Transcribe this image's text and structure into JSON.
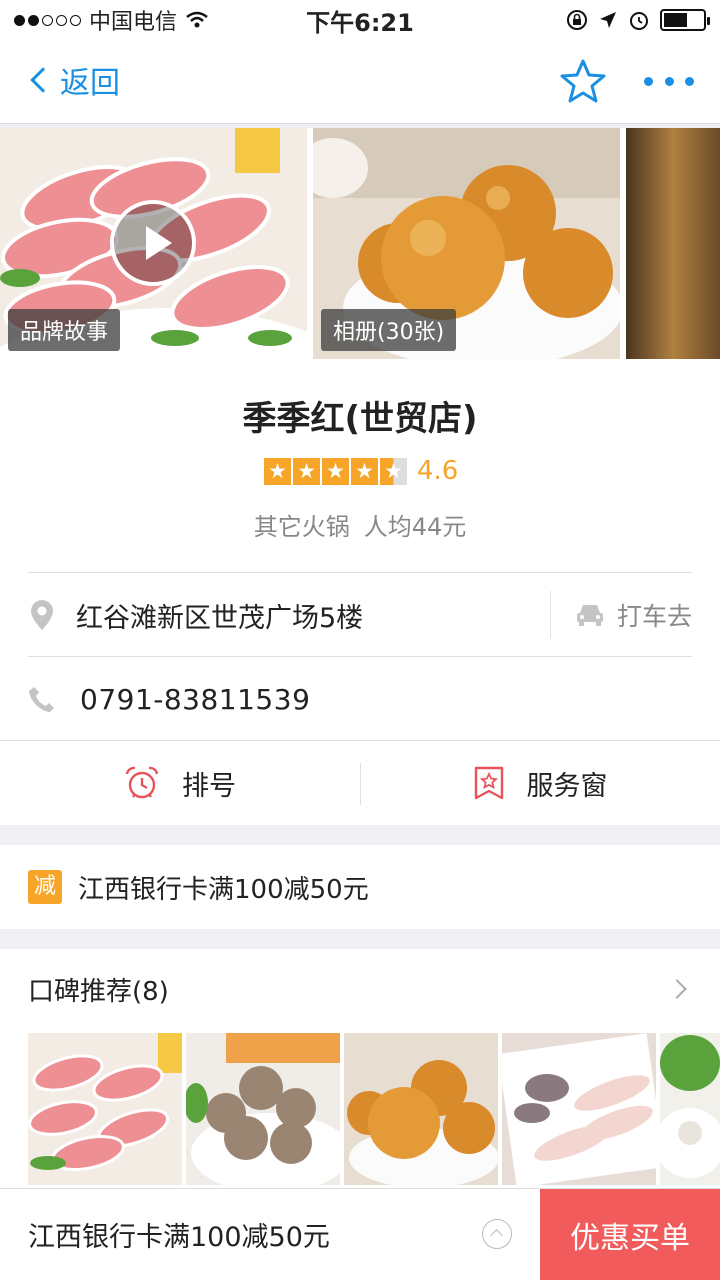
{
  "status_bar": {
    "carrier": "中国电信",
    "time": "下午6:21",
    "battery_level": 0.6
  },
  "nav": {
    "back_label": "返回",
    "icons": [
      "back-chevron-icon",
      "star-icon",
      "more-icon"
    ]
  },
  "gallery": {
    "items": [
      {
        "tag": "品牌故事",
        "icon": "play-icon"
      },
      {
        "tag": "相册(30张)"
      },
      {
        "tag": ""
      }
    ]
  },
  "shop": {
    "name": "季季红(世贸店)",
    "rating": "4.6",
    "rating_value": 4.6,
    "category": "其它火锅",
    "avg_price": "人均44元",
    "address": "红谷滩新区世茂广场5楼",
    "taxi_label": "打车去",
    "phone": "0791-83811539"
  },
  "actions": [
    {
      "label": "排号",
      "icon": "alarm-clock-icon"
    },
    {
      "label": "服务窗",
      "icon": "service-window-icon"
    }
  ],
  "promo": {
    "badge": "减",
    "text": "江西银行卡满100减50元"
  },
  "recommend": {
    "title": "口碑推荐(8)"
  },
  "bottom_bar": {
    "text": "江西银行卡满100减50元",
    "pay_label": "优惠买单"
  },
  "colors": {
    "accent_blue": "#1a8fe3",
    "star_orange": "#f7a529",
    "pay_red": "#f15b5b",
    "icon_red": "#e8545b"
  }
}
